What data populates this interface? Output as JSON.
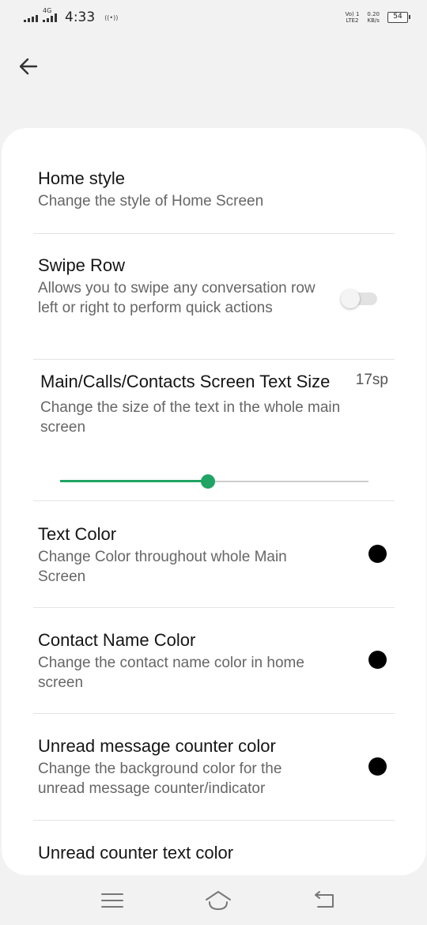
{
  "status_bar": {
    "network": "4G",
    "time": "4:33",
    "hotspot": "((•))",
    "volte_top": "Vo) 1",
    "volte_bottom": "LTE2",
    "speed_value": "0.20",
    "speed_unit": "KB/s",
    "battery": "54"
  },
  "colors": {
    "accent": "#1fa463",
    "background": "#f2f2f2",
    "card": "#ffffff",
    "dot": "#000000"
  },
  "settings": [
    {
      "title": "Home style",
      "desc": "Change the style of Home Screen"
    },
    {
      "title": "Swipe Row",
      "desc": "Allows you to swipe any conversation row left or right to perform quick actions",
      "toggle": false
    },
    {
      "title": "Main/Calls/Contacts Screen Text Size",
      "desc": "Change the size of the text in the whole main screen",
      "value": "17sp",
      "slider_fraction": 0.48
    },
    {
      "title": "Text Color",
      "desc": "Change Color throughout whole Main Screen",
      "color": "#000000"
    },
    {
      "title": "Contact Name Color",
      "desc": "Change the contact name color in home screen",
      "color": "#000000"
    },
    {
      "title": "Unread message counter color",
      "desc": "Change the background color for the unread message counter/indicator",
      "color": "#000000"
    },
    {
      "title": "Unread counter text color"
    }
  ],
  "icons": {
    "back": "arrow-left-icon",
    "menu": "menu-icon",
    "home": "home-icon",
    "return": "return-icon"
  }
}
